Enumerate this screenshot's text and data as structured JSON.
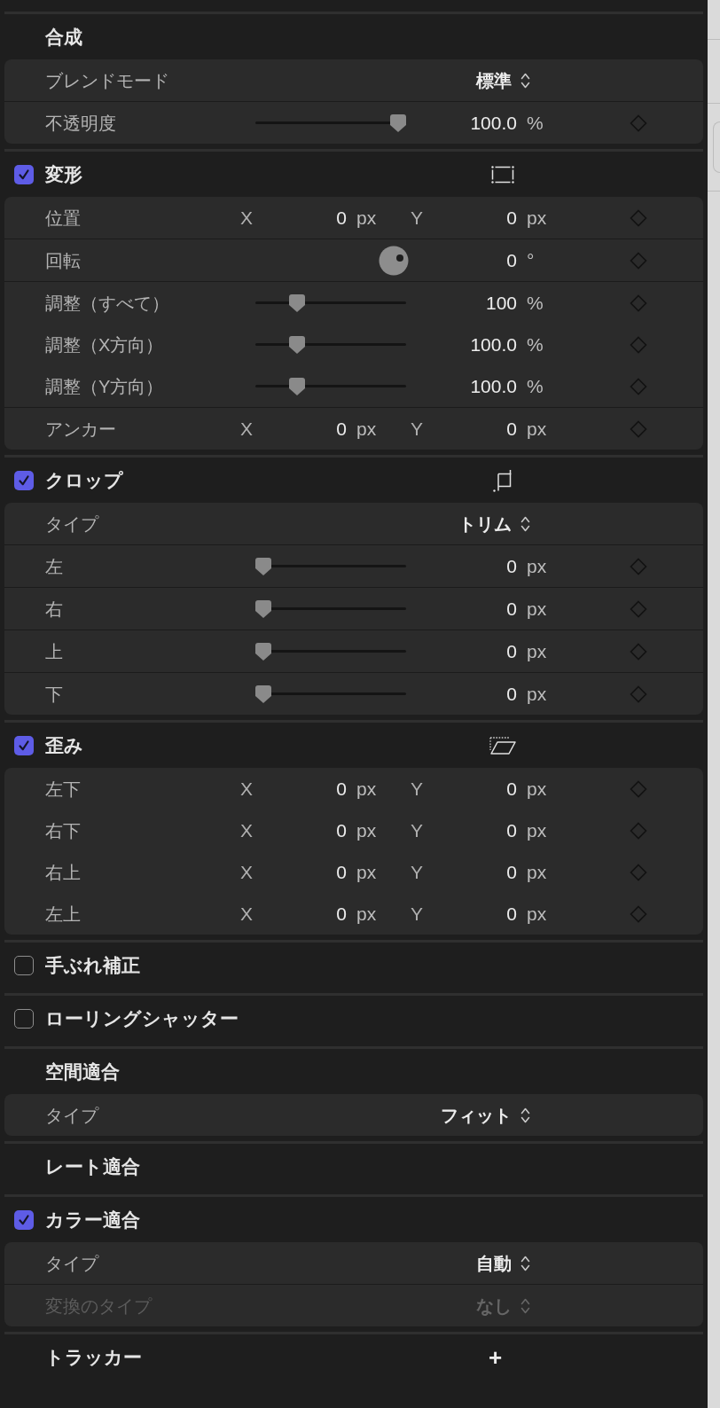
{
  "sections": [
    {
      "title": "合成",
      "kind": "plain",
      "blocks": [
        {
          "rows": [
            {
              "kind": "popup",
              "label": "ブレンドモード",
              "value": "標準",
              "disabled": false
            }
          ]
        },
        {
          "rows": [
            {
              "kind": "slider",
              "label": "不透明度",
              "level": 1,
              "value": "100.0",
              "unit": "%"
            }
          ]
        }
      ]
    },
    {
      "title": "変形",
      "kind": "transform",
      "checked": true,
      "blocks": [
        {
          "rows": [
            {
              "kind": "xy",
              "label": "位置",
              "x_label": "X",
              "x_value": "0",
              "x_unit": "px",
              "y_label": "Y",
              "y_value": "0",
              "y_unit": "px"
            }
          ]
        },
        {
          "rows": [
            {
              "kind": "dial",
              "label": "回転",
              "value": "0",
              "unit": "°"
            }
          ]
        },
        {
          "rows": [
            {
              "kind": "slider",
              "label": "調整（すべて）",
              "level": 0.25,
              "value": "100",
              "unit": "%"
            },
            {
              "kind": "slider",
              "label": "調整（X方向）",
              "level": 0.25,
              "value": "100.0",
              "unit": "%"
            },
            {
              "kind": "slider",
              "label": "調整（Y方向）",
              "level": 0.25,
              "value": "100.0",
              "unit": "%"
            }
          ]
        },
        {
          "rows": [
            {
              "kind": "xy",
              "label": "アンカー",
              "x_label": "X",
              "x_value": "0",
              "x_unit": "px",
              "y_label": "Y",
              "y_value": "0",
              "y_unit": "px"
            }
          ]
        }
      ]
    },
    {
      "title": "クロップ",
      "kind": "crop",
      "checked": true,
      "blocks": [
        {
          "rows": [
            {
              "kind": "popup",
              "label": "タイプ",
              "value": "トリム",
              "disabled": false
            }
          ]
        },
        {
          "rows": [
            {
              "kind": "slider",
              "label": "左",
              "level": 0,
              "value": "0",
              "unit": "px"
            }
          ]
        },
        {
          "rows": [
            {
              "kind": "slider",
              "label": "右",
              "level": 0,
              "value": "0",
              "unit": "px"
            }
          ]
        },
        {
          "rows": [
            {
              "kind": "slider",
              "label": "上",
              "level": 0,
              "value": "0",
              "unit": "px"
            }
          ]
        },
        {
          "rows": [
            {
              "kind": "slider",
              "label": "下",
              "level": 0,
              "value": "0",
              "unit": "px"
            }
          ]
        }
      ]
    },
    {
      "title": "歪み",
      "kind": "distort",
      "checked": true,
      "blocks": [
        {
          "rows": [
            {
              "kind": "xy",
              "label": "左下",
              "x_label": "X",
              "x_value": "0",
              "x_unit": "px",
              "y_label": "Y",
              "y_value": "0",
              "y_unit": "px"
            },
            {
              "kind": "xy",
              "label": "右下",
              "x_label": "X",
              "x_value": "0",
              "x_unit": "px",
              "y_label": "Y",
              "y_value": "0",
              "y_unit": "px"
            },
            {
              "kind": "xy",
              "label": "右上",
              "x_label": "X",
              "x_value": "0",
              "x_unit": "px",
              "y_label": "Y",
              "y_value": "0",
              "y_unit": "px"
            },
            {
              "kind": "xy",
              "label": "左上",
              "x_label": "X",
              "x_value": "0",
              "x_unit": "px",
              "y_label": "Y",
              "y_value": "0",
              "y_unit": "px"
            }
          ]
        }
      ]
    },
    {
      "title": "手ぶれ補正",
      "kind": "plain",
      "checked": false
    },
    {
      "title": "ローリングシャッター",
      "kind": "plain",
      "checked": false
    },
    {
      "title": "空間適合",
      "kind": "plain",
      "blocks": [
        {
          "rows": [
            {
              "kind": "popup",
              "label": "タイプ",
              "value": "フィット",
              "disabled": false
            }
          ]
        }
      ]
    },
    {
      "title": "レート適合",
      "kind": "plain"
    },
    {
      "title": "カラー適合",
      "kind": "plain",
      "checked": true,
      "blocks": [
        {
          "rows": [
            {
              "kind": "popup",
              "label": "タイプ",
              "value": "自動",
              "disabled": false
            }
          ]
        },
        {
          "rows": [
            {
              "kind": "popup",
              "label": "変換のタイプ",
              "value": "なし",
              "disabled": true
            }
          ]
        }
      ]
    },
    {
      "title": "トラッカー",
      "kind": "plain",
      "add_button": "+"
    }
  ]
}
